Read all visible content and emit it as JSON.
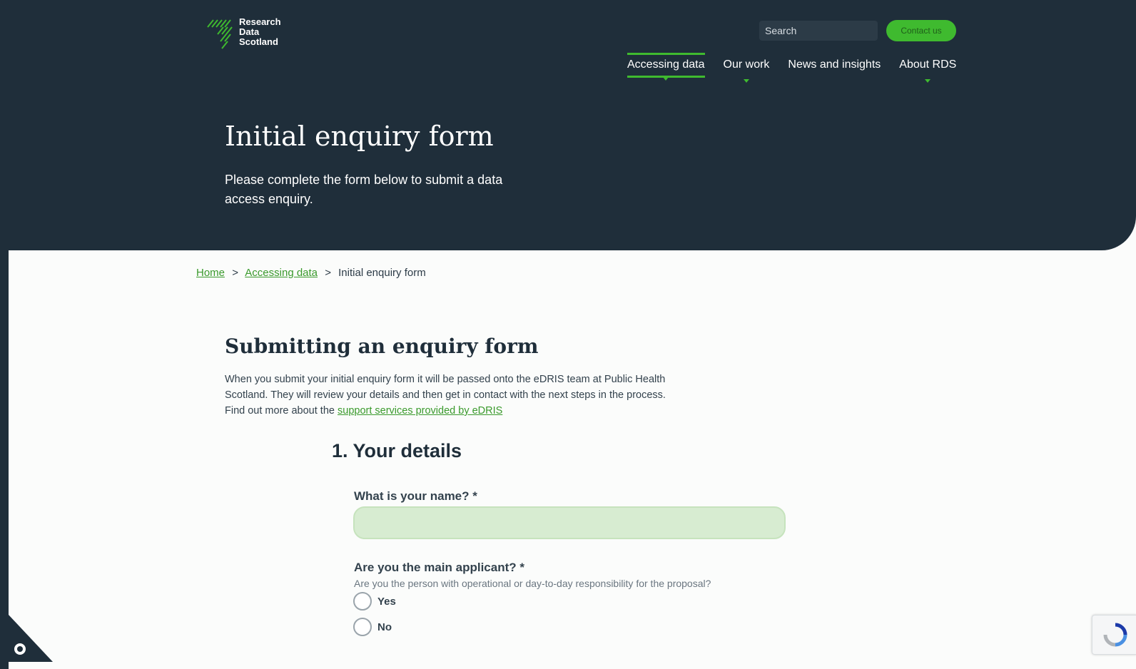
{
  "header": {
    "logo_lines": [
      "Research",
      "Data",
      "Scotland"
    ],
    "search_placeholder": "Search",
    "contact_label": "Contact us",
    "nav": [
      {
        "label": "Accessing data",
        "active": true,
        "has_dropdown": true
      },
      {
        "label": "Our work",
        "active": false,
        "has_dropdown": true
      },
      {
        "label": "News and insights",
        "active": false,
        "has_dropdown": false
      },
      {
        "label": "About RDS",
        "active": false,
        "has_dropdown": true
      }
    ],
    "colors": {
      "background": "#1f2e3a",
      "accent": "#3fba2f"
    }
  },
  "hero": {
    "title": "Initial enquiry form",
    "subtitle": "Please complete the form below to submit a data access enquiry."
  },
  "breadcrumb": {
    "items": [
      "Home",
      "Accessing data"
    ],
    "current": "Initial enquiry form",
    "separator": ">"
  },
  "main": {
    "section_title": "Submitting an enquiry form",
    "intro_text": "When you submit your initial enquiry form it will be passed onto the eDRIS team at Public Health Scotland. They will review your details and  then get in contact with the next steps in the process. Find out more about the ",
    "intro_link": "support services provided by eDRIS",
    "step_title": "1. Your details",
    "name_label": "What is your name? *",
    "name_value": "",
    "applicant_label": "Are you the main applicant? *",
    "applicant_hint": "Are you the person with operational or day-to-day responsibility for the proposal?",
    "options": [
      "Yes",
      "No"
    ]
  },
  "icons": {
    "search": "search-icon",
    "corner": "cookie-settings-icon",
    "recaptcha": "recaptcha-icon"
  }
}
